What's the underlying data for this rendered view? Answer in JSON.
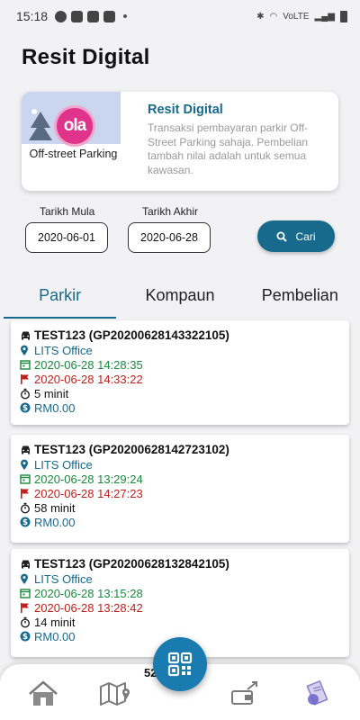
{
  "status_bar": {
    "time": "15:18",
    "network_label": "VoLTE"
  },
  "page_title": "Resit Digital",
  "info_card": {
    "image_caption": "Off-street Parking",
    "title": "Resit Digital",
    "description": "Transaksi pembayaran parkir Off-Street Parking sahaja. Pembelian tambah nilai adalah untuk semua kawasan."
  },
  "filters": {
    "start_label": "Tarikh Mula",
    "start_value": "2020-06-01",
    "end_label": "Tarikh Akhir",
    "end_value": "2020-06-28",
    "search_label": "Cari"
  },
  "tabs": [
    {
      "label": "Parkir",
      "active": true
    },
    {
      "label": "Kompaun",
      "active": false
    },
    {
      "label": "Pembelian",
      "active": false
    }
  ],
  "records": [
    {
      "plate": "TEST123 (GP20200628143322105)",
      "location": "LITS Office",
      "start": "2020-06-28 14:28:35",
      "end": "2020-06-28 14:33:22",
      "duration": "5 minit",
      "amount": "RM0.00"
    },
    {
      "plate": "TEST123 (GP20200628142723102)",
      "location": "LITS Office",
      "start": "2020-06-28 13:29:24",
      "end": "2020-06-28 14:27:23",
      "duration": "58 minit",
      "amount": "RM0.00"
    },
    {
      "plate": "TEST123 (GP20200628132842105)",
      "location": "LITS Office",
      "start": "2020-06-28 13:15:28",
      "end": "2020-06-28 13:28:42",
      "duration": "14 minit",
      "amount": "RM0.00"
    }
  ],
  "peek_text": "52 2",
  "colors": {
    "primary": "#176a8c",
    "start_green": "#1a8a3d",
    "end_red": "#c0201b",
    "logo_pink": "#e0338b"
  },
  "icons": {
    "nav": [
      "home-icon",
      "map-icon",
      "qr-code-icon",
      "wallet-icon",
      "receipt-icon"
    ]
  }
}
